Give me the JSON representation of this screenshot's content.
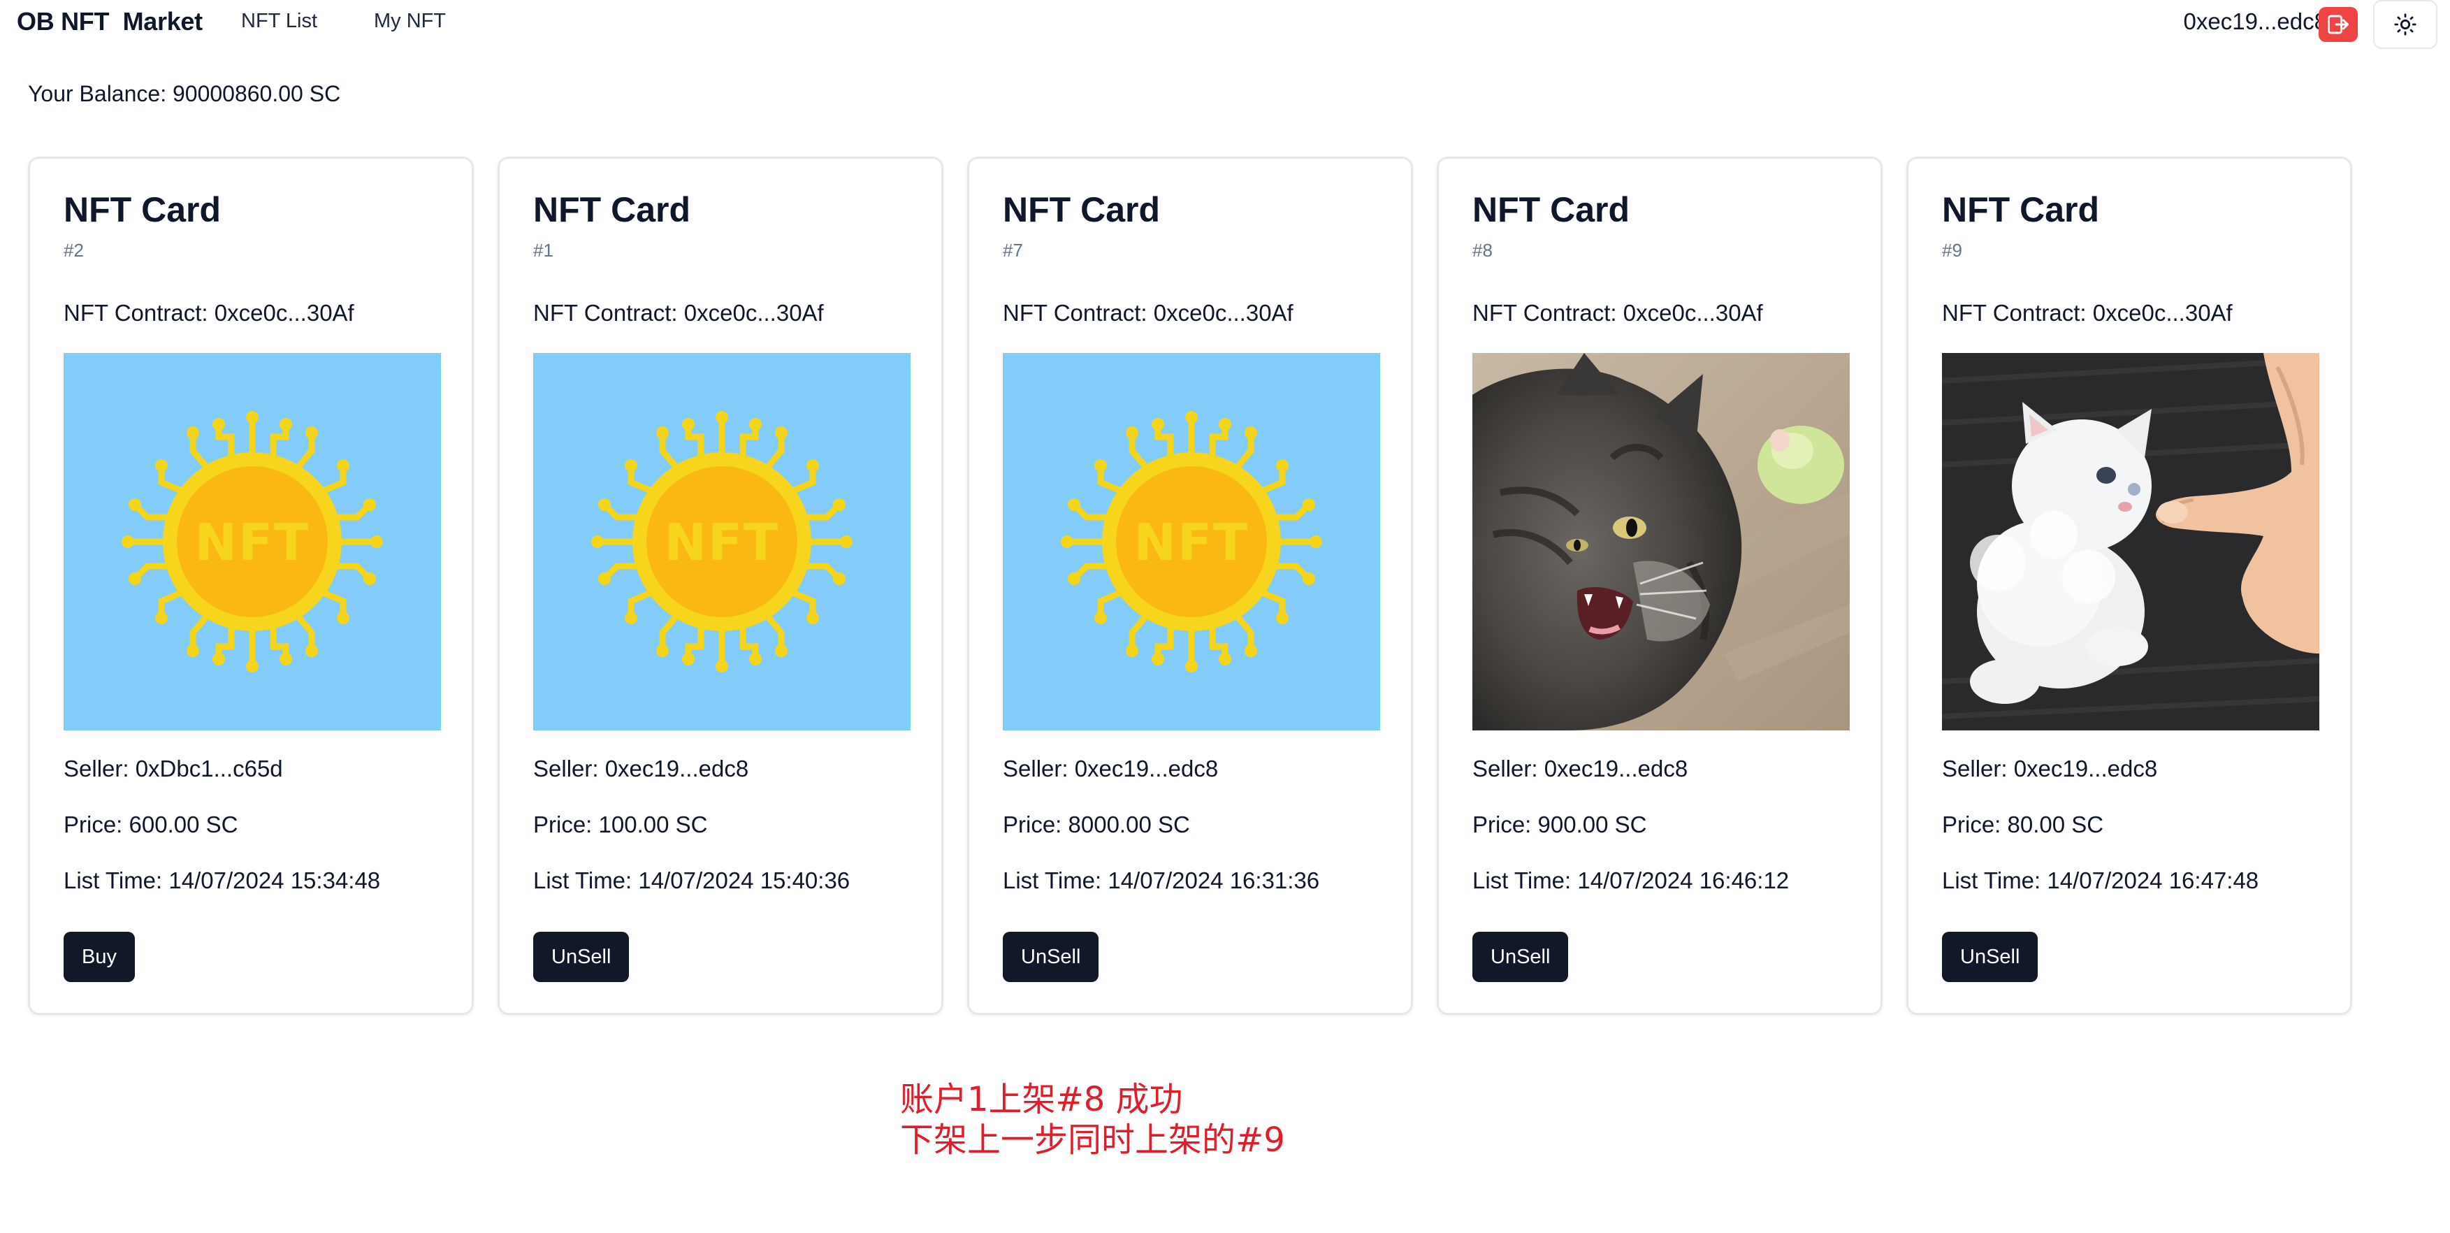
{
  "header": {
    "brand": "OB NFT  Market",
    "nav": [
      "NFT List",
      "My NFT"
    ],
    "account_address": "0xec19...edc8",
    "logout_icon": "logout-icon",
    "theme_icon": "sun-icon",
    "logout_color": "#ef4444"
  },
  "balance": {
    "text": "Your Balance: 90000860.00 SC"
  },
  "cards": [
    {
      "title": "NFT Card",
      "id": "#2",
      "contract": "NFT Contract: 0xce0c...30Af",
      "image": "nft-coin-image",
      "seller": "Seller: 0xDbc1...c65d",
      "price": "Price: 600.00 SC",
      "list_time": "List Time: 14/07/2024 15:34:48",
      "button": "Buy"
    },
    {
      "title": "NFT Card",
      "id": "#1",
      "contract": "NFT Contract: 0xce0c...30Af",
      "image": "nft-coin-image",
      "seller": "Seller: 0xec19...edc8",
      "price": "Price: 100.00 SC",
      "list_time": "List Time: 14/07/2024 15:40:36",
      "button": "UnSell"
    },
    {
      "title": "NFT Card",
      "id": "#7",
      "contract": "NFT Contract: 0xce0c...30Af",
      "image": "nft-coin-image",
      "seller": "Seller: 0xec19...edc8",
      "price": "Price: 8000.00 SC",
      "list_time": "List Time: 14/07/2024 16:31:36",
      "button": "UnSell"
    },
    {
      "title": "NFT Card",
      "id": "#8",
      "contract": "NFT Contract: 0xce0c...30Af",
      "image": "tabby-cat-photo",
      "seller": "Seller: 0xec19...edc8",
      "price": "Price: 900.00 SC",
      "list_time": "List Time: 14/07/2024 16:46:12",
      "button": "UnSell"
    },
    {
      "title": "NFT Card",
      "id": "#9",
      "contract": "NFT Contract: 0xce0c...30Af",
      "image": "white-kitten-photo",
      "seller": "Seller: 0xec19...edc8",
      "price": "Price: 80.00 SC",
      "list_time": "List Time: 14/07/2024 16:47:48",
      "button": "UnSell"
    }
  ],
  "annotation": {
    "line1": "账户1上架#8 成功",
    "line2": "下架上一步同时上架的#9",
    "color": "#e11d2a"
  }
}
